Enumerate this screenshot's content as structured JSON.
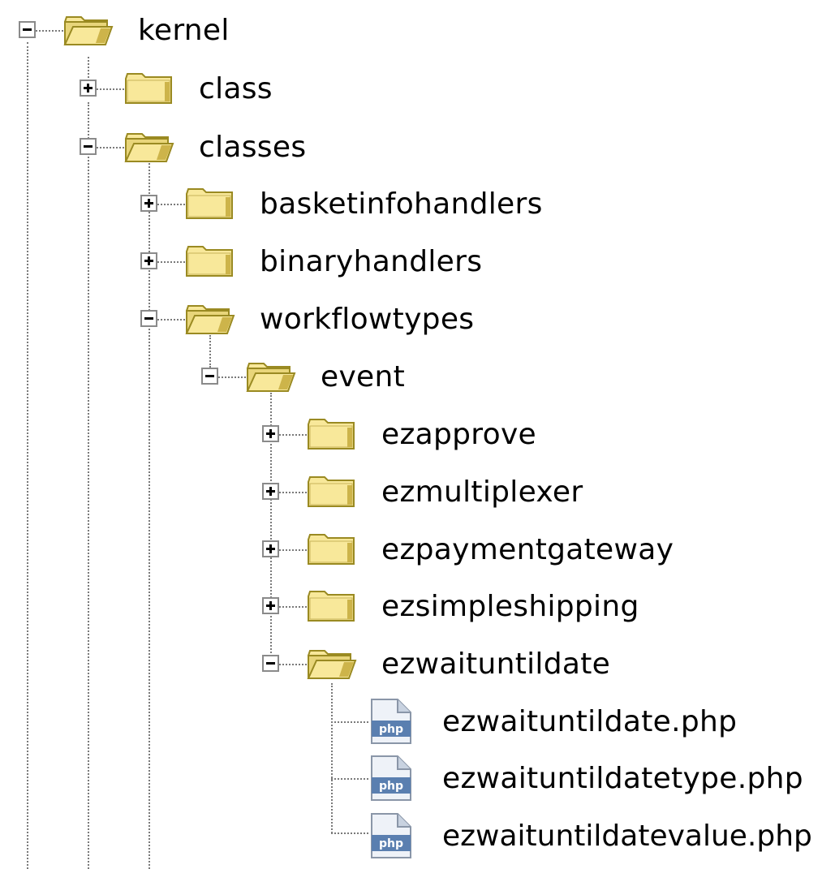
{
  "tree": {
    "root": {
      "label": "kernel",
      "expanded": true,
      "icon": "folder-open-icon"
    },
    "items": [
      {
        "label": "class",
        "expanded": false,
        "icon": "folder-closed-icon"
      },
      {
        "label": "classes",
        "expanded": true,
        "icon": "folder-open-icon"
      },
      {
        "label": "basketinfohandlers",
        "expanded": false,
        "icon": "folder-closed-icon"
      },
      {
        "label": "binaryhandlers",
        "expanded": false,
        "icon": "folder-closed-icon"
      },
      {
        "label": "workflowtypes",
        "expanded": true,
        "icon": "folder-open-icon"
      },
      {
        "label": "event",
        "expanded": true,
        "icon": "folder-open-icon"
      },
      {
        "label": "ezapprove",
        "expanded": false,
        "icon": "folder-closed-icon"
      },
      {
        "label": "ezmultiplexer",
        "expanded": false,
        "icon": "folder-closed-icon"
      },
      {
        "label": "ezpaymentgateway",
        "expanded": false,
        "icon": "folder-closed-icon"
      },
      {
        "label": "ezsimpleshipping",
        "expanded": false,
        "icon": "folder-closed-icon"
      },
      {
        "label": "ezwaituntildate",
        "expanded": true,
        "icon": "folder-open-icon"
      }
    ],
    "files": [
      {
        "label": "ezwaituntildate.php",
        "icon": "php-file-icon",
        "badge": "php"
      },
      {
        "label": "ezwaituntildatetype.php",
        "icon": "php-file-icon",
        "badge": "php"
      },
      {
        "label": "ezwaituntildatevalue.php",
        "icon": "php-file-icon",
        "badge": "php"
      }
    ]
  },
  "colors": {
    "folder": "#f8e89a",
    "folder_edge": "#9a8a22",
    "lines": "#7a7a7a",
    "php_icon": "#5a7fb0"
  }
}
